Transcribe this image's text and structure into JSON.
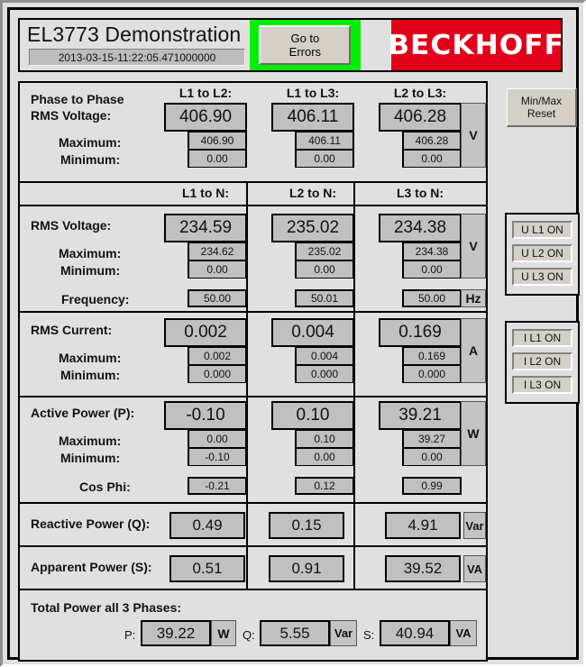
{
  "header": {
    "title": "EL3773 Demonstration",
    "timestamp": "2013-03-15-11:22:05.471000000",
    "errors_button_line1": "Go to",
    "errors_button_line2": "Errors",
    "brand": "BECKHOFF",
    "green_color": "#00ef00",
    "brand_color": "#e3001b"
  },
  "sidebar": {
    "reset_button_line1": "Min/Max",
    "reset_button_line2": "Reset",
    "voltage_indicators": [
      "U L1 ON",
      "U L2 ON",
      "U L3 ON"
    ],
    "current_indicators": [
      "I L1 ON",
      "I L2 ON",
      "I L3 ON"
    ]
  },
  "sections": {
    "phase_to_phase": {
      "label_line1": "Phase to Phase",
      "label_line2": "RMS Voltage:",
      "maximum_label": "Maximum:",
      "minimum_label": "Minimum:",
      "unit": "V",
      "columns": [
        {
          "header": "L1 to L2:",
          "value": "406.90",
          "maximum": "406.90",
          "minimum": "0.00"
        },
        {
          "header": "L1 to L3:",
          "value": "406.11",
          "maximum": "406.11",
          "minimum": "0.00"
        },
        {
          "header": "L2 to L3:",
          "value": "406.28",
          "maximum": "406.28",
          "minimum": "0.00"
        }
      ]
    },
    "phase_to_neutral": {
      "headers": [
        "L1 to N:",
        "L2 to N:",
        "L3 to N:"
      ],
      "rms_label": "RMS Voltage:",
      "maximum_label": "Maximum:",
      "minimum_label": "Minimum:",
      "frequency_label": "Frequency:",
      "unit": "V",
      "frequency_unit": "Hz",
      "columns": [
        {
          "value": "234.59",
          "maximum": "234.62",
          "minimum": "0.00",
          "frequency": "50.00"
        },
        {
          "value": "235.02",
          "maximum": "235.02",
          "minimum": "0.00",
          "frequency": "50.01"
        },
        {
          "value": "234.38",
          "maximum": "234.38",
          "minimum": "0.00",
          "frequency": "50.00"
        }
      ]
    },
    "rms_current": {
      "label": "RMS Current:",
      "maximum_label": "Maximum:",
      "minimum_label": "Minimum:",
      "unit": "A",
      "columns": [
        {
          "value": "0.002",
          "maximum": "0.002",
          "minimum": "0.000"
        },
        {
          "value": "0.004",
          "maximum": "0.004",
          "minimum": "0.000"
        },
        {
          "value": "0.169",
          "maximum": "0.169",
          "minimum": "0.000"
        }
      ]
    },
    "active_power": {
      "label": "Active Power (P):",
      "maximum_label": "Maximum:",
      "minimum_label": "Minimum:",
      "cos_phi_label": "Cos Phi:",
      "unit": "W",
      "columns": [
        {
          "value": "-0.10",
          "maximum": "0.00",
          "minimum": "-0.10",
          "cos_phi": "-0.21"
        },
        {
          "value": "0.10",
          "maximum": "0.10",
          "minimum": "0.00",
          "cos_phi": "0.12"
        },
        {
          "value": "39.21",
          "maximum": "39.27",
          "minimum": "0.00",
          "cos_phi": "0.99"
        }
      ]
    },
    "reactive_power": {
      "label": "Reactive Power (Q):",
      "unit": "Var",
      "values": [
        "0.49",
        "0.15",
        "4.91"
      ]
    },
    "apparent_power": {
      "label": "Apparent Power (S):",
      "unit": "VA",
      "values": [
        "0.51",
        "0.91",
        "39.52"
      ]
    },
    "total_power": {
      "label": "Total Power all 3 Phases:",
      "p_label": "P:",
      "p_value": "39.22",
      "p_unit": "W",
      "q_label": "Q:",
      "q_value": "5.55",
      "q_unit": "Var",
      "s_label": "S:",
      "s_value": "40.94",
      "s_unit": "VA"
    }
  }
}
